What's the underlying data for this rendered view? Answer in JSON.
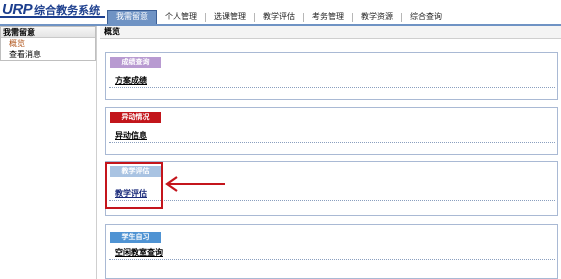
{
  "header": {
    "logo_main": "URP",
    "logo_sub": "综合教务系统",
    "tabs": [
      "我需留意",
      "个人管理",
      "选课管理",
      "教学评估",
      "考务管理",
      "教学资源",
      "综合查询"
    ],
    "active_tab_index": 0,
    "accent_color": "#6f93c4"
  },
  "sidebar": {
    "title": "我需留意",
    "items": [
      {
        "label": "概览",
        "current": true
      },
      {
        "label": "查看消息",
        "current": false
      }
    ]
  },
  "main": {
    "title": "概览",
    "sections": [
      {
        "badge": "成绩查询",
        "badge_color": "#b89ad1",
        "link": "方案成绩"
      },
      {
        "badge": "异动情况",
        "badge_color": "#c2151b",
        "link": "异动信息"
      },
      {
        "badge": "教学评估",
        "badge_color": "#a9c3e2",
        "link": "教学评估",
        "highlighted": true
      },
      {
        "badge": "学生自习",
        "badge_color": "#4f93d3",
        "link": "空闲教室查询"
      }
    ]
  },
  "annotation": {
    "highlight_color": "#c4151c",
    "arrow_color": "#c4151c"
  }
}
